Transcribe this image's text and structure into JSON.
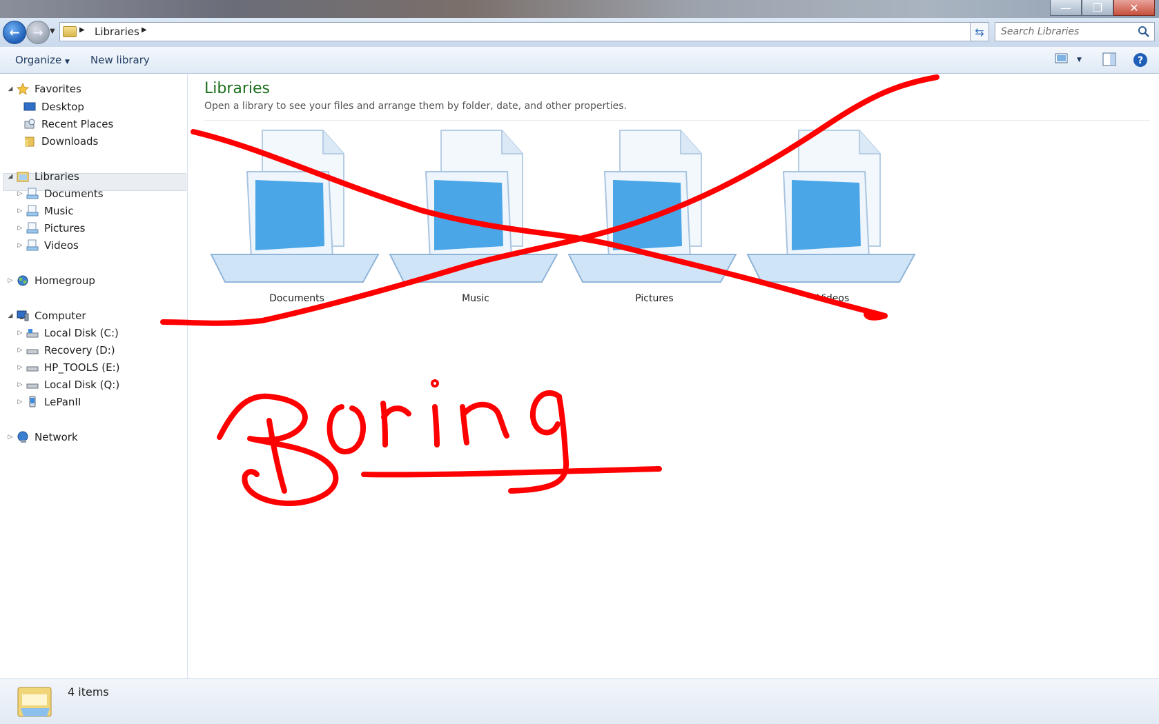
{
  "window": {
    "minimize_glyph": "—",
    "restore_glyph": "❐",
    "close_glyph": "✕"
  },
  "address": {
    "crumb": "Libraries",
    "search_placeholder": "Search Libraries"
  },
  "toolbar": {
    "organize_label": "Organize",
    "new_library_label": "New library"
  },
  "nav": {
    "favorites": {
      "label": "Favorites",
      "items": [
        "Desktop",
        "Recent Places",
        "Downloads"
      ]
    },
    "libraries": {
      "label": "Libraries",
      "items": [
        "Documents",
        "Music",
        "Pictures",
        "Videos"
      ]
    },
    "homegroup": {
      "label": "Homegroup"
    },
    "computer": {
      "label": "Computer",
      "items": [
        "Local Disk (C:)",
        "Recovery (D:)",
        "HP_TOOLS (E:)",
        "Local Disk (Q:)",
        "LePanII"
      ]
    },
    "network": {
      "label": "Network"
    }
  },
  "content": {
    "title": "Libraries",
    "subtitle": "Open a library to see your files and arrange them by folder, date, and other properties.",
    "libraries": [
      "Documents",
      "Music",
      "Pictures",
      "Videos"
    ]
  },
  "status": {
    "count_text": "4 items"
  },
  "annotation": {
    "handwritten_text": "Boring",
    "color": "#ff0000"
  },
  "colors": {
    "title_green": "#1b6e1b",
    "accent_blue": "#2e6db5",
    "scribble_red": "#ff0000"
  }
}
